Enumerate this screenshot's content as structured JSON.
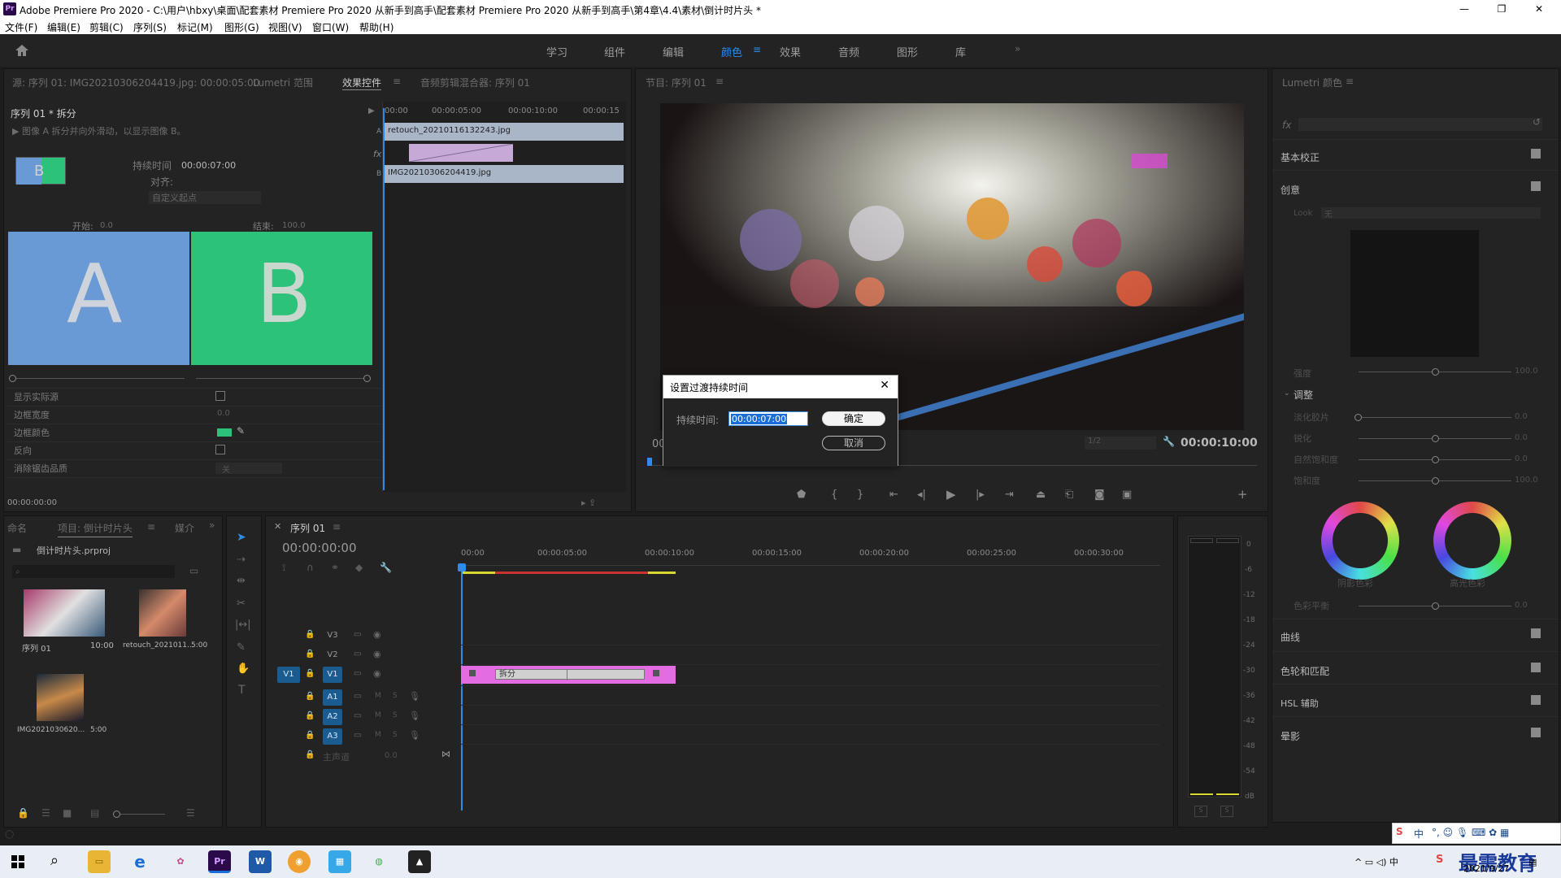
{
  "window": {
    "title": "Adobe Premiere Pro 2020 - C:\\用户\\hbxy\\桌面\\配套素材 Premiere Pro 2020 从新手到高手\\配套素材 Premiere Pro 2020 从新手到高手\\第4章\\4.4\\素材\\倒计时片头 *",
    "app_icon": "Pr"
  },
  "menu": [
    "文件(F)",
    "编辑(E)",
    "剪辑(C)",
    "序列(S)",
    "标记(M)",
    "图形(G)",
    "视图(V)",
    "窗口(W)",
    "帮助(H)"
  ],
  "workspaces": [
    "学习",
    "组件",
    "编辑",
    "颜色",
    "效果",
    "音频",
    "图形",
    "库"
  ],
  "active_workspace": "颜色",
  "effect_controls": {
    "tab_source": "源: 序列 01: IMG20210306204419.jpg: 00:00:05:00",
    "tab_lumetri": "Lumetri 范围",
    "tab_active": "效果控件",
    "tab_mixer": "音频剪辑混合器: 序列 01",
    "clip_label": "序列 01 * 拆分",
    "description": "图像 A 拆分并向外滑动，以显示图像 B。",
    "duration_label": "持续时间",
    "duration_value": "00:00:07:00",
    "align_label": "对齐:",
    "align_value": "自定义起点",
    "start_label": "开始:",
    "start_value": "0.0",
    "end_label": "结束:",
    "end_value": "100.0",
    "preview_a": "A",
    "preview_b": "B",
    "mini_preview": "B",
    "props": [
      {
        "label": "显示实际源",
        "value": ""
      },
      {
        "label": "边框宽度",
        "value": "0.0"
      },
      {
        "label": "边框颜色",
        "value": ""
      },
      {
        "label": "反向",
        "value": ""
      },
      {
        "label": "消除锯齿品质",
        "value": "关"
      }
    ],
    "time_ruler": [
      "00:00",
      "00:00:05:00",
      "00:00:10:00",
      "00:00:15"
    ],
    "track_a_clip": "retouch_20210116132243.jpg",
    "track_b_clip": "IMG20210306204419.jpg",
    "track_letters": [
      "A",
      "fx",
      "B"
    ],
    "timecode": "00:00:00:00"
  },
  "program_monitor": {
    "tab": "节目: 序列 01",
    "left_timecode": "00",
    "scale": "1/2",
    "right_timecode": "00:00:10:00",
    "controls": [
      "marker-icon",
      "in-icon",
      "out-icon",
      "go-in-icon",
      "step-back-icon",
      "play-icon",
      "step-fwd-icon",
      "go-out-icon",
      "lift-icon",
      "extract-icon",
      "export-frame-icon",
      "compare-icon",
      "add-icon"
    ]
  },
  "dialog": {
    "title": "设置过渡持续时间",
    "label": "持续时间:",
    "value": "00:00:07:00",
    "ok": "确定",
    "cancel": "取消"
  },
  "lumetri": {
    "tab": "Lumetri 颜色",
    "fx_label": "fx",
    "sections": [
      "基本校正",
      "创意",
      "曲线",
      "色轮和匹配",
      "HSL 辅助",
      "晕影"
    ],
    "look_label": "Look",
    "look_value": "无",
    "intensity_label": "强度",
    "intensity_value": "100.0",
    "adjust_label": "调整",
    "adjust_rows": [
      {
        "label": "淡化胶片",
        "value": "0.0"
      },
      {
        "label": "锐化",
        "value": "0.0"
      },
      {
        "label": "自然饱和度",
        "value": "0.0"
      },
      {
        "label": "饱和度",
        "value": "100.0"
      }
    ],
    "wheel_shadow": "阴影色彩",
    "wheel_highlight": "高光色彩",
    "balance_label": "色彩平衡",
    "balance_value": "0.0"
  },
  "project": {
    "tab_name": "命名",
    "tab_project": "项目: 倒计时片头",
    "tab_media": "媒介",
    "project_file": "倒计时片头.prproj",
    "items": [
      {
        "name": "序列 01",
        "dur": "10:00"
      },
      {
        "name": "retouch_2021011...",
        "dur": "5:00"
      },
      {
        "name": "IMG2021030620...",
        "dur": "5:00"
      }
    ]
  },
  "timeline": {
    "tab": "序列 01",
    "timecode": "00:00:00:00",
    "ruler": [
      "00:00",
      "00:00:05:00",
      "00:00:10:00",
      "00:00:15:00",
      "00:00:20:00",
      "00:00:25:00",
      "00:00:30:00"
    ],
    "video_tracks": [
      "V3",
      "V2",
      "V1"
    ],
    "audio_tracks": [
      "A1",
      "A2",
      "A3"
    ],
    "source_v1": "V1",
    "master_label": "主声道",
    "master_value": "0.0",
    "transition_label": "拆分",
    "mute": "M",
    "solo": "S"
  },
  "audio_meter": {
    "ticks": [
      "0",
      "-6",
      "-12",
      "-18",
      "-24",
      "-30",
      "-36",
      "-42",
      "-48",
      "-54",
      "dB"
    ],
    "solo_buttons": [
      "S",
      "S"
    ]
  },
  "taskbar": {
    "ime": "中",
    "time": "",
    "date": "2021/9/27",
    "watermark": "最需教育"
  },
  "colors": {
    "accent": "#2d8ceb",
    "preview_a": "#6a9ad6",
    "preview_b": "#2cc27a",
    "transition_pink": "#e36ce3",
    "track_blue": "#1b5c90"
  }
}
